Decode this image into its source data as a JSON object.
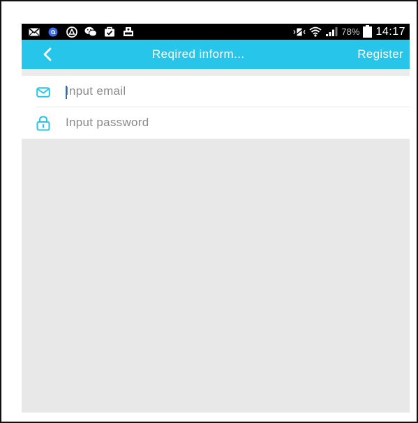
{
  "status_bar": {
    "icons": [
      "mail-icon",
      "at-icon",
      "android-icon",
      "wechat-icon",
      "bag-check-icon",
      "photo-icon"
    ],
    "right_icons": [
      "vibrate-icon",
      "wifi-icon",
      "signal-icon"
    ],
    "battery_percent": "78%",
    "time": "14:17"
  },
  "app_bar": {
    "back_icon": "chevron-left-icon",
    "title": "Reqired inform...",
    "register_label": "Register",
    "color": "#27c5ea"
  },
  "form": {
    "email": {
      "icon": "envelope-icon",
      "placeholder": "Input email",
      "value": ""
    },
    "password": {
      "icon": "lock-icon",
      "placeholder": "Input password",
      "value": ""
    }
  },
  "colors": {
    "accent": "#27c5ea",
    "background": "#e8e8e8"
  }
}
